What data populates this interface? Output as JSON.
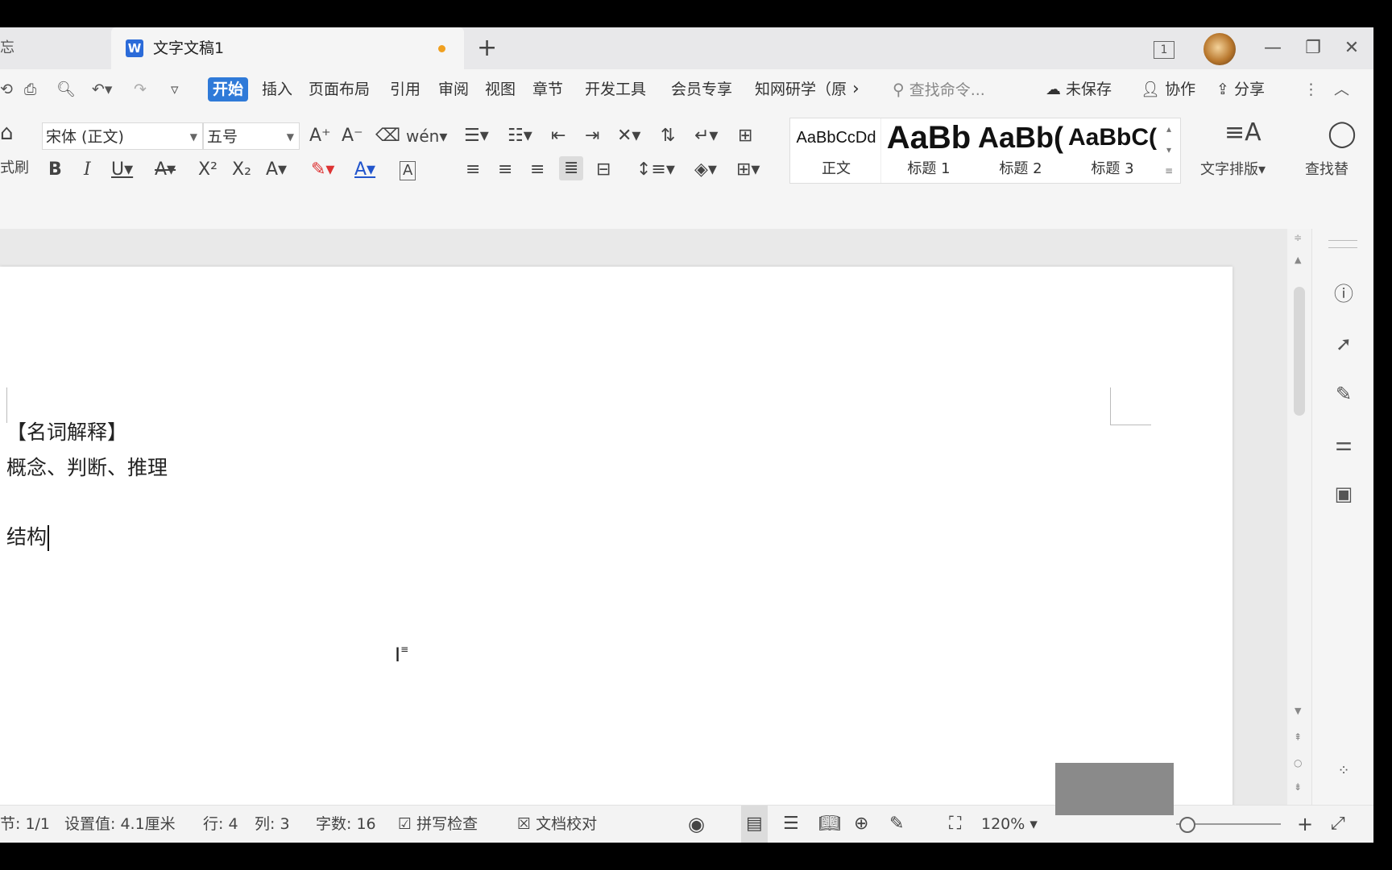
{
  "titlebar": {
    "left_tab_fragment": "忘",
    "doc_tab_title": "文字文稿1",
    "new_tab": "+",
    "page_count_icon": "1",
    "minimize": "—",
    "restore": "❐",
    "close": "✕"
  },
  "menu": {
    "items": [
      "开始",
      "插入",
      "页面布局",
      "引用",
      "审阅",
      "视图",
      "章节",
      "开发工具",
      "会员专享",
      "知网研学（原"
    ],
    "more_arrow": "›",
    "search_placeholder": "查找命令...",
    "unsaved": "未保存",
    "collab": "协作",
    "share": "分享",
    "overflow": "⋮",
    "collapse": "︿"
  },
  "ribbon": {
    "format_painter_label": "式刷",
    "font_name": "宋体 (正文)",
    "font_size": "五号",
    "styles": [
      {
        "preview": "AaBbCcDd",
        "label": "正文"
      },
      {
        "preview": "AaBb",
        "label": "标题 1"
      },
      {
        "preview": "AaBb(",
        "label": "标题 2"
      },
      {
        "preview": "AaBbC(",
        "label": "标题 3"
      }
    ],
    "text_layout_label": "文字排版",
    "find_replace_label": "查找替"
  },
  "document": {
    "lines": [
      "【名词解释】",
      "概念、判断、推理",
      "",
      "结构"
    ]
  },
  "statusbar": {
    "section": "节: 1/1",
    "setting": "设置值: 4.1厘米",
    "row": "行: 4",
    "col": "列: 3",
    "word_count": "字数: 16",
    "spell_check": "拼写检查",
    "doc_proof": "文档校对",
    "zoom": "120%"
  },
  "colors": {
    "accent": "#2f7ad8",
    "unsaved_dot": "#f0a020",
    "word_icon": "#2b6bd9"
  }
}
